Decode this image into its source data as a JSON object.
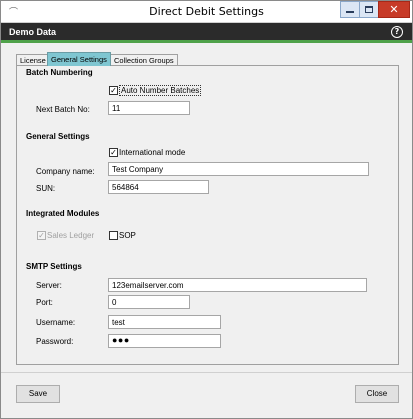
{
  "window": {
    "title": "Direct Debit Settings",
    "app_icon": "app-icon",
    "controls": {
      "minimize": "minimize-icon",
      "maximize": "maximize-icon",
      "close": "✕"
    }
  },
  "header": {
    "title": "Demo Data",
    "help_label": "?"
  },
  "tabs": [
    {
      "label": "License",
      "active": false
    },
    {
      "label": "General Settings",
      "active": true
    },
    {
      "label": "Collection Groups",
      "active": false
    }
  ],
  "batch_numbering": {
    "heading": "Batch Numbering",
    "auto_number_label": "Auto Number Batches",
    "auto_number_checked": true,
    "next_batch_label": "Next Batch No:",
    "next_batch_value": "11"
  },
  "general_settings": {
    "heading": "General Settings",
    "international_label": "International mode",
    "international_checked": true,
    "company_label": "Company name:",
    "company_value": "Test Company",
    "sun_label": "SUN:",
    "sun_value": "564864"
  },
  "integrated_modules": {
    "heading": "Integrated Modules",
    "sales_ledger_label": "Sales Ledger",
    "sales_ledger_checked": true,
    "sales_ledger_enabled": false,
    "sop_label": "SOP",
    "sop_checked": false
  },
  "smtp": {
    "heading": "SMTP Settings",
    "server_label": "Server:",
    "server_value": "123emailserver.com",
    "port_label": "Port:",
    "port_value": "0",
    "username_label": "Username:",
    "username_value": "test",
    "password_label": "Password:",
    "password_value": "●●●"
  },
  "footer": {
    "save_label": "Save",
    "close_label": "Close"
  },
  "colors": {
    "header_bg": "#2b2b2b",
    "header_accent": "#4fa24a",
    "active_tab": "#7fc6d1",
    "close_button": "#c73b28"
  }
}
